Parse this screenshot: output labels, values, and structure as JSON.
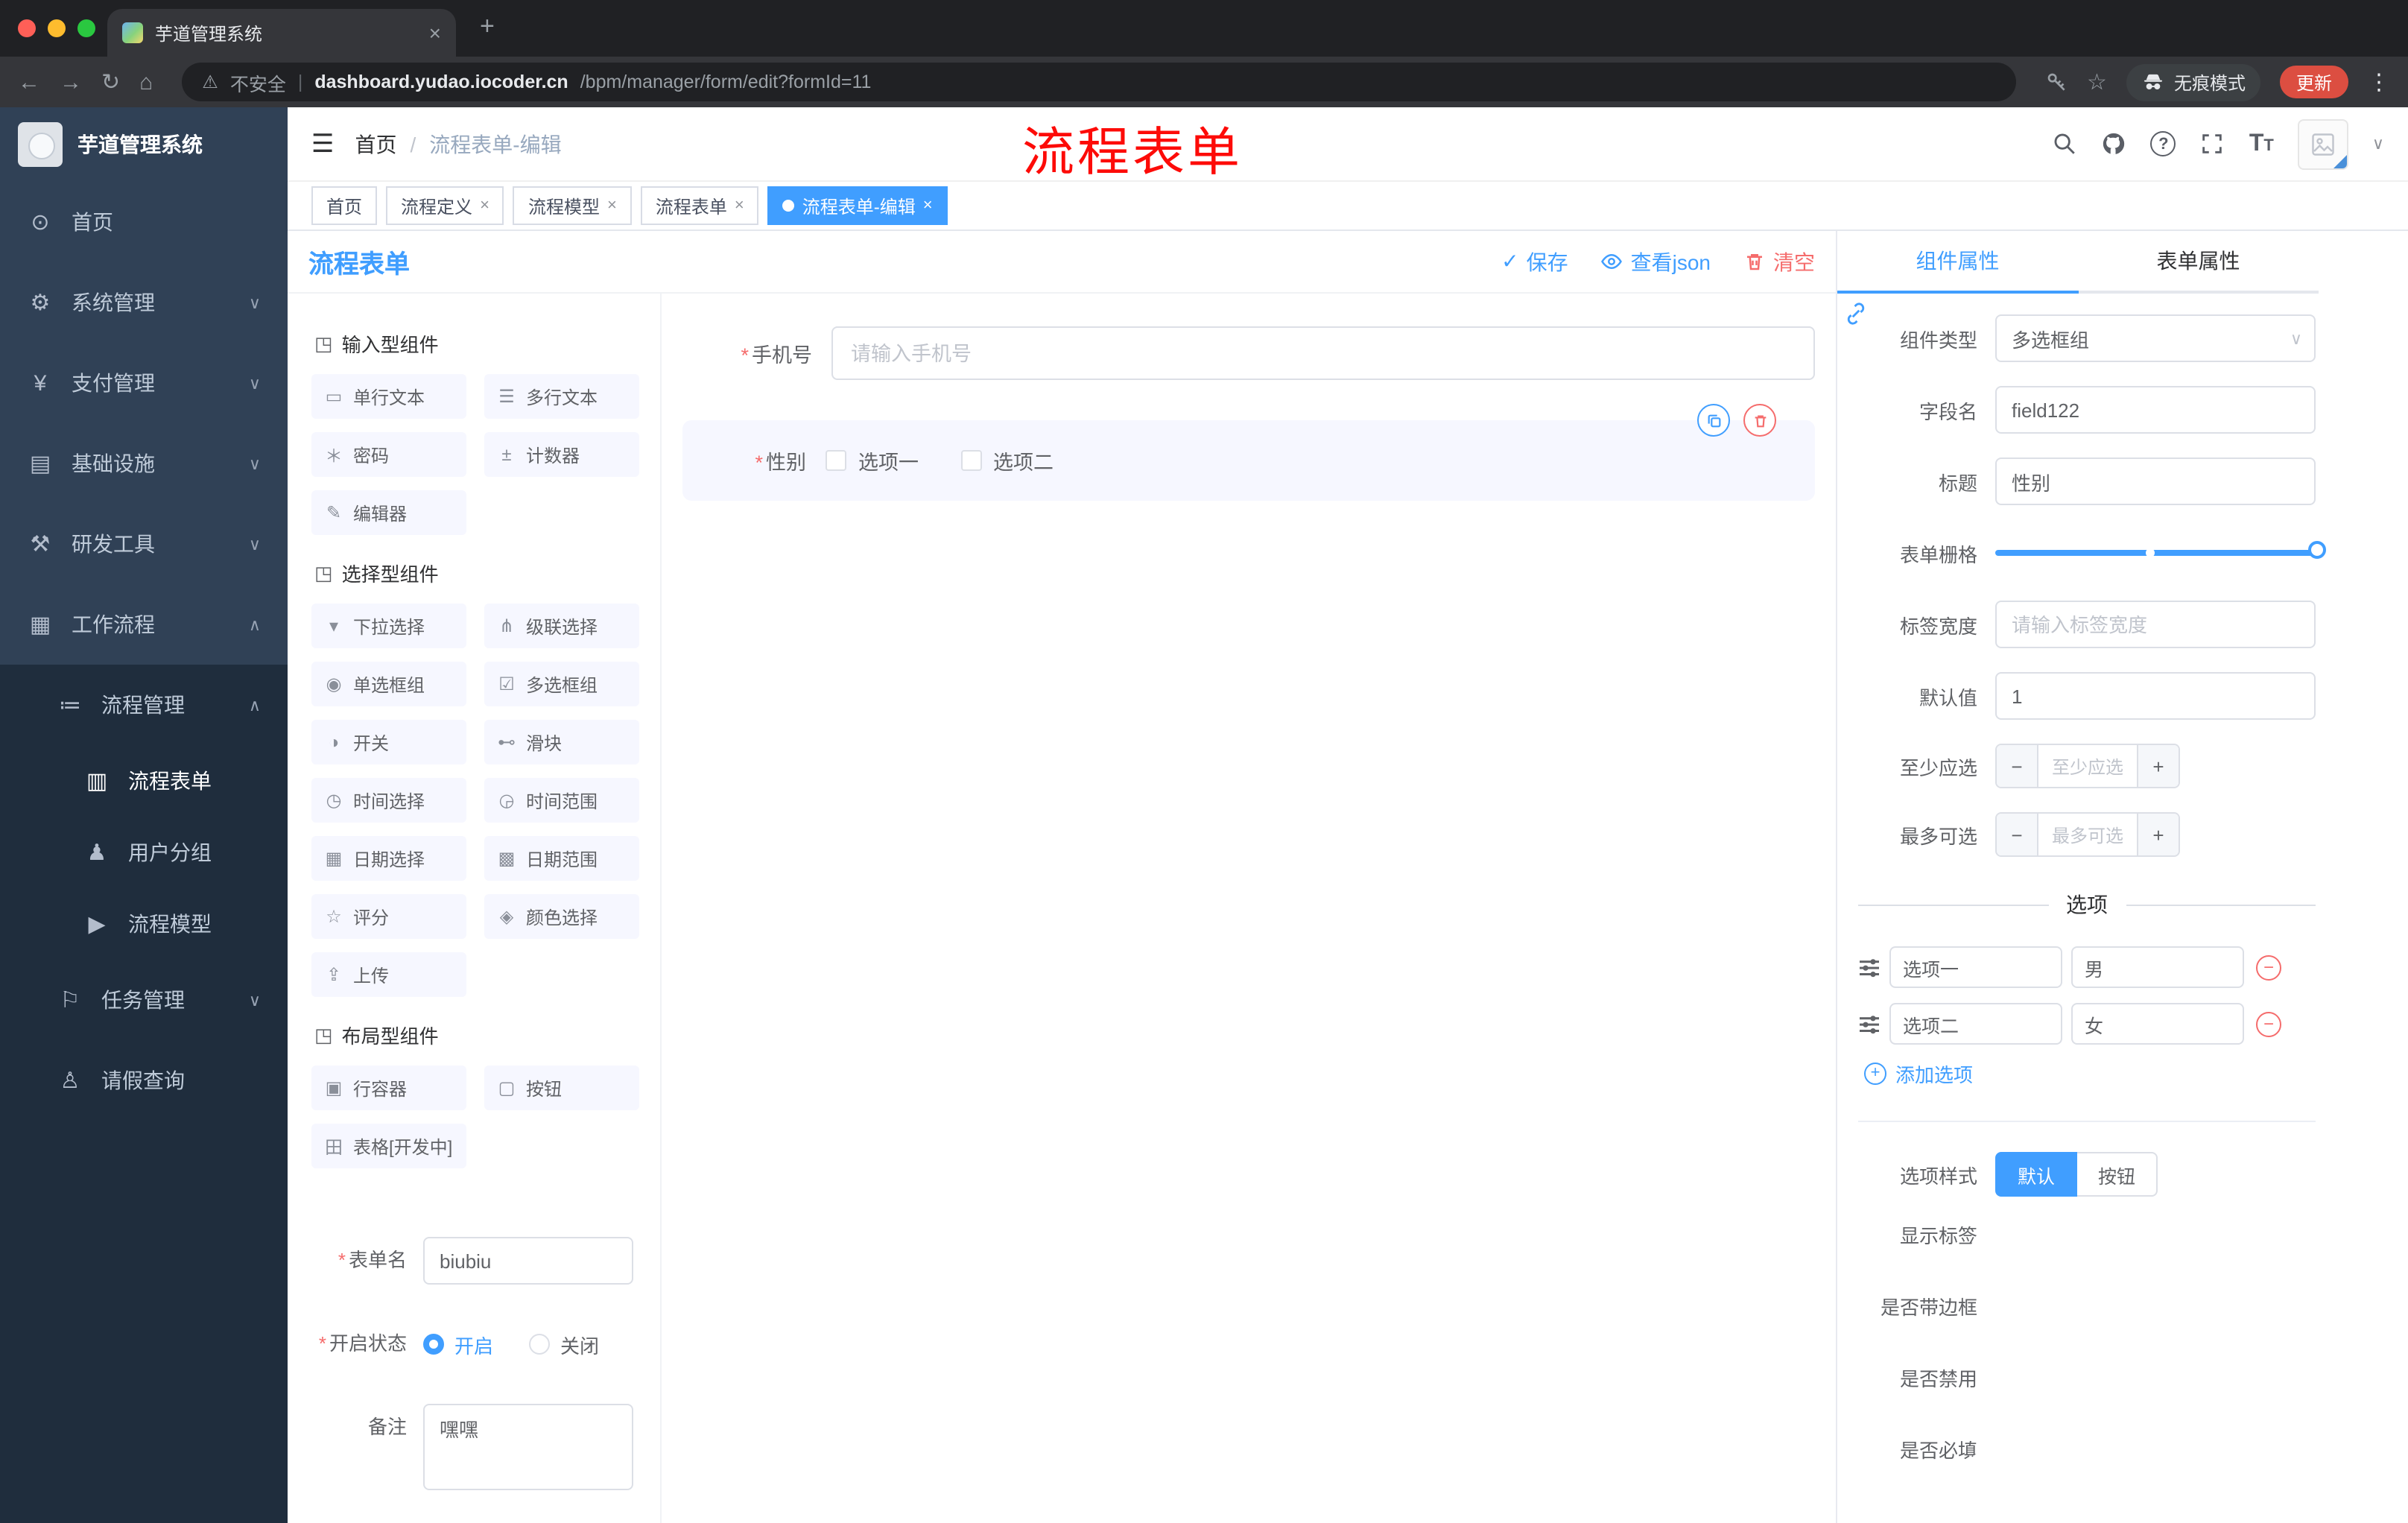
{
  "browser": {
    "tab_title": "芋道管理系统",
    "security_label": "不安全",
    "url_domain": "dashboard.yudao.iocoder.cn",
    "url_path": "/bpm/manager/form/edit?formId=11",
    "incognito_label": "无痕模式",
    "update_label": "更新"
  },
  "sidebar": {
    "brand": "芋道管理系统",
    "items": {
      "home": "首页",
      "system": "系统管理",
      "pay": "支付管理",
      "infra": "基础设施",
      "dev": "研发工具",
      "workflow": "工作流程",
      "process": "流程管理",
      "form": "流程表单",
      "group": "用户分组",
      "model": "流程模型",
      "task": "任务管理",
      "leave": "请假查询"
    }
  },
  "header": {
    "breadcrumb_home": "首页",
    "breadcrumb_current": "流程表单-编辑",
    "annotation": "流程表单"
  },
  "tags": [
    {
      "label": "首页",
      "active": false
    },
    {
      "label": "流程定义",
      "active": false
    },
    {
      "label": "流程模型",
      "active": false
    },
    {
      "label": "流程表单",
      "active": false
    },
    {
      "label": "流程表单-编辑",
      "active": true
    }
  ],
  "editor": {
    "title": "流程表单",
    "save": "保存",
    "view_json": "查看json",
    "clear": "清空"
  },
  "palette": {
    "sections": [
      {
        "title": "输入型组件",
        "items": [
          "单行文本",
          "多行文本",
          "密码",
          "计数器",
          "编辑器"
        ]
      },
      {
        "title": "选择型组件",
        "items": [
          "下拉选择",
          "级联选择",
          "单选框组",
          "多选框组",
          "开关",
          "滑块",
          "时间选择",
          "时间范围",
          "日期选择",
          "日期范围",
          "评分",
          "颜色选择",
          "上传"
        ]
      },
      {
        "title": "布局型组件",
        "items": [
          "行容器",
          "按钮",
          "表格[开发中]"
        ]
      }
    ]
  },
  "form_meta": {
    "name_label": "表单名",
    "name_value": "biubiu",
    "status_label": "开启状态",
    "status_on": "开启",
    "status_off": "关闭",
    "status_value": "开启",
    "remark_label": "备注",
    "remark_value": "嘿嘿"
  },
  "canvas": {
    "phone_label": "手机号",
    "phone_placeholder": "请输入手机号",
    "gender_label": "性别",
    "gender_opt1": "选项一",
    "gender_opt2": "选项二"
  },
  "props": {
    "tab_component": "组件属性",
    "tab_form": "表单属性",
    "type_label": "组件类型",
    "type_value": "多选框组",
    "field_label": "字段名",
    "field_value": "field122",
    "title_label": "标题",
    "title_value": "性别",
    "grid_label": "表单栅格",
    "width_label": "标签宽度",
    "width_placeholder": "请输入标签宽度",
    "default_label": "默认值",
    "default_value": "1",
    "min_label": "至少应选",
    "min_placeholder": "至少应选",
    "max_label": "最多可选",
    "max_placeholder": "最多可选",
    "options_title": "选项",
    "options": [
      {
        "name": "选项一",
        "value": "男"
      },
      {
        "name": "选项二",
        "value": "女"
      }
    ],
    "add_option": "添加选项",
    "style_label": "选项样式",
    "style_default": "默认",
    "style_button": "按钮",
    "switches": [
      {
        "label": "显示标签",
        "on": true
      },
      {
        "label": "是否带边框",
        "on": false
      },
      {
        "label": "是否禁用",
        "on": false
      },
      {
        "label": "是否必填",
        "on": true
      }
    ]
  },
  "colors": {
    "accent": "#409eff",
    "danger": "#f56c6c",
    "annotation": "#fd0b08",
    "sidebar": "#304156",
    "sidebar_submenu": "#1f2d3d"
  },
  "icons": {
    "hamburger": "☰",
    "back": "←",
    "forward": "→",
    "reload": "↻",
    "home": "⌂",
    "warning": "⚠",
    "divider": "|",
    "star": "☆",
    "more": "⋮",
    "plus": "+",
    "close": "×",
    "caret_down": "∨",
    "caret_up": "∧",
    "crumb_sep": "/",
    "check": "✓",
    "question": "?",
    "font_big": "T",
    "font_small": "T",
    "asterisk": "*",
    "minus": "−",
    "menu_home": "⊙",
    "menu_system": "⚙",
    "menu_pay": "¥",
    "menu_infra": "▤",
    "menu_dev": "⚒",
    "menu_workflow": "▦",
    "menu_process": "≔",
    "menu_form": "▥",
    "menu_group": "♟",
    "menu_model": "▶",
    "menu_task": "⚐",
    "menu_leave": "♙",
    "sec_cube": "◳",
    "c_text": "▭",
    "c_textarea": "☰",
    "c_password": "＊",
    "c_counter": "±",
    "c_editor": "✎",
    "c_select": "▾",
    "c_cascade": "⋔",
    "c_radio": "◉",
    "c_checkbox": "☑",
    "c_switch": "◑",
    "c_slider": "⊷",
    "c_time": "◷",
    "c_timerange": "◶",
    "c_date": "▦",
    "c_daterange": "▩",
    "c_rate": "☆",
    "c_color": "◈",
    "c_upload": "⇪",
    "c_row": "▣",
    "c_button": "▢",
    "c_table": "田"
  }
}
